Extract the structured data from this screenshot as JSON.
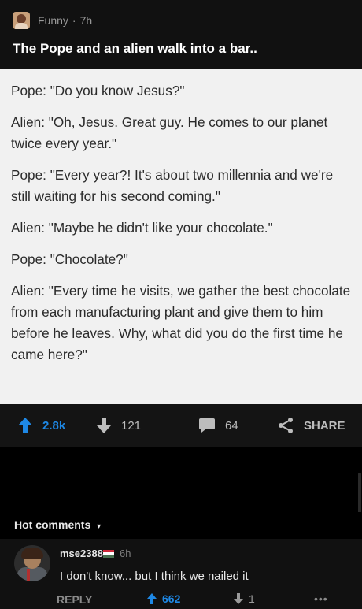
{
  "post": {
    "section": "Funny",
    "separator": "·",
    "age": "7h",
    "title": "The Pope and an alien walk into a bar.."
  },
  "image_text": {
    "lines": [
      "Pope: \"Do you know Jesus?\"",
      "Alien: \"Oh, Jesus. Great guy. He comes to our planet twice every year.\"",
      "Pope: \"Every year?! It's about two millennia and we're still waiting for his second coming.\"",
      "Alien: \"Maybe he didn't like your chocolate.\"",
      "Pope: \"Chocolate?\"",
      "Alien: \"Every time he visits, we gather the best chocolate from each manufacturing plant and give them to him before he leaves. Why, what did you do the first time he came here?\""
    ]
  },
  "actions": {
    "upvotes": "2.8k",
    "downvotes": "121",
    "comments": "64",
    "share_label": "SHARE"
  },
  "comments_section": {
    "header": "Hot comments",
    "caret": "▾",
    "top_comment": {
      "username": "mse2388",
      "age": "6h",
      "text": "I don't know... but I think we nailed it",
      "reply_label": "REPLY",
      "upvotes": "662",
      "downvotes": "1",
      "more": "•••"
    }
  },
  "colors": {
    "accent_upvote": "#1e88e5",
    "background": "#000000",
    "card": "#111111",
    "image_bg": "#f1f1f1"
  },
  "icons": {
    "upvote": "arrow-up-icon",
    "downvote": "arrow-down-icon",
    "comments": "speech-bubble-icon",
    "share": "share-icon",
    "flag": "hungary-flag-icon"
  }
}
